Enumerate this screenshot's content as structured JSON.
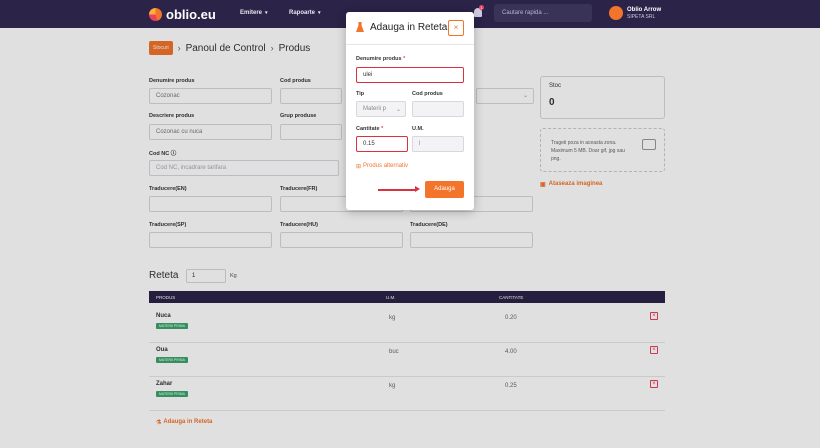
{
  "topbar": {
    "logo": "oblio.eu",
    "nav": [
      {
        "label": "Emitere"
      },
      {
        "label": "Rapoarte"
      }
    ],
    "notification_count": "1",
    "search_placeholder": "Cautare rapida ...",
    "user_name": "Oblio Arrow",
    "user_company": "SIPETA SRL"
  },
  "breadcrumb": {
    "badge": "Stocuri",
    "sep": "›",
    "items": [
      "Panoul de Control",
      "Produs"
    ]
  },
  "form": {
    "denumire_label": "Denumire produs",
    "denumire_value": "Cozonac",
    "cod_label": "Cod produs",
    "descriere_label": "Descriere produs",
    "descriere_value": "Cozonac cu nuca",
    "grup_label": "Grup produse",
    "codnc_label": "Cod NC",
    "codnc_placeholder": "Cod NC, incadrare tarifara",
    "trad_en_label": "Traducere(EN)",
    "trad_fr_label": "Traducere(FR)",
    "trad_sp_label": "Traducere(SP)",
    "trad_hu_label": "Traducere(HU)",
    "trad_de_label": "Traducere(DE)"
  },
  "stoc": {
    "label": "Stoc",
    "value": "0"
  },
  "upload": {
    "text": "Trageti poza in aceasta zona. Maximum 5 MB. Doar gif, jpg sau png.",
    "attach_label": "Ataseaza imaginea"
  },
  "reteta": {
    "title": "Reteta",
    "qty": "1",
    "unit": "Kg",
    "columns": [
      "PRODUS",
      "U.M.",
      "CANTITATE"
    ],
    "rows": [
      {
        "name": "Nuca",
        "tag": "MATERII PRIMA",
        "um": "kg",
        "qty": "0.20"
      },
      {
        "name": "Oua",
        "tag": "MATERII PRIMA",
        "um": "buc",
        "qty": "4.00"
      },
      {
        "name": "Zahar",
        "tag": "MATERII PRIMA",
        "um": "kg",
        "qty": "0.25"
      }
    ],
    "add_label": "Adauga in Reteta"
  },
  "modal": {
    "title": "Adauga in Reteta",
    "close": "×",
    "denumire_label": "Denumire produs",
    "denumire_value": "ulei",
    "tip_label": "Tip",
    "tip_value": "Materii p",
    "cod_label": "Cod produs",
    "cantitate_label": "Cantitate",
    "cantitate_value": "0.15",
    "um_label": "U.M.",
    "um_value": "l",
    "alt_label": "Produs alternativ",
    "submit_label": "Adauga"
  },
  "colors": {
    "accent": "#f3742b",
    "topbar": "#2b2348",
    "error": "#d9323f",
    "tag": "#3aa56b"
  }
}
